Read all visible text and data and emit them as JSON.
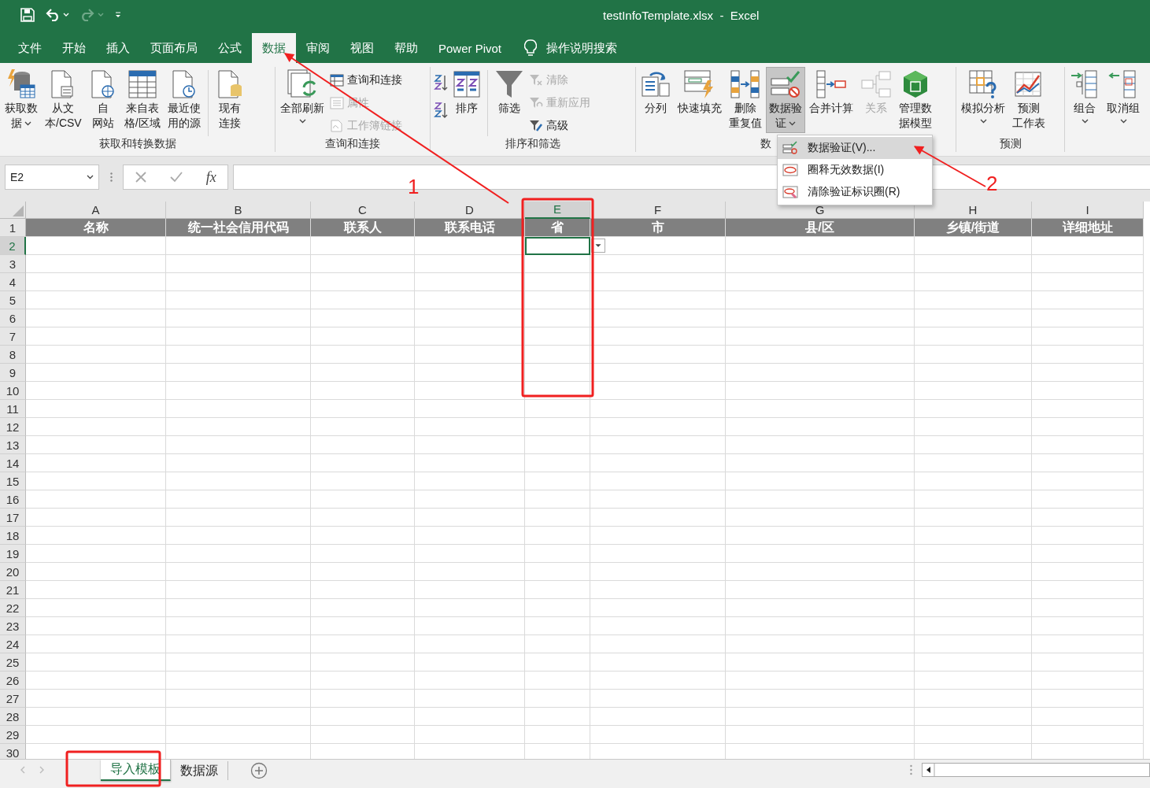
{
  "title_bar": {
    "title": "testInfoTemplate.xlsx  -  Excel"
  },
  "menu_tabs": [
    {
      "label": "文件",
      "selected": false
    },
    {
      "label": "开始",
      "selected": false
    },
    {
      "label": "插入",
      "selected": false
    },
    {
      "label": "页面布局",
      "selected": false
    },
    {
      "label": "公式",
      "selected": false
    },
    {
      "label": "数据",
      "selected": true
    },
    {
      "label": "审阅",
      "selected": false
    },
    {
      "label": "视图",
      "selected": false
    },
    {
      "label": "帮助",
      "selected": false
    },
    {
      "label": "Power Pivot",
      "selected": false
    }
  ],
  "tell_me": {
    "label": "操作说明搜索"
  },
  "ribbon_groups": [
    {
      "label": "获取和转换数据",
      "items": [
        {
          "kind": "large",
          "lines": [
            "获取数",
            "据"
          ],
          "caret": true,
          "disabled": false,
          "pressed": false
        },
        {
          "kind": "large",
          "lines": [
            "从文",
            "本/CSV"
          ],
          "caret": false,
          "disabled": false,
          "pressed": false
        },
        {
          "kind": "large",
          "lines": [
            "自",
            "网站"
          ],
          "caret": false,
          "disabled": false,
          "pressed": false
        },
        {
          "kind": "large",
          "lines": [
            "来自表",
            "格/区域"
          ],
          "caret": false,
          "disabled": false,
          "pressed": false
        },
        {
          "kind": "large",
          "lines": [
            "最近使",
            "用的源"
          ],
          "caret": false,
          "disabled": false,
          "pressed": false
        },
        {
          "kind": "separator"
        },
        {
          "kind": "large",
          "lines": [
            "现有",
            "连接"
          ],
          "caret": false,
          "disabled": false,
          "pressed": false
        }
      ]
    },
    {
      "label": "查询和连接",
      "items": [
        {
          "kind": "large",
          "lines": [
            "全部刷新"
          ],
          "caret": true,
          "disabled": false,
          "pressed": false
        },
        {
          "kind": "stack",
          "items": [
            {
              "label": "查询和连接",
              "disabled": false
            },
            {
              "label": "属性",
              "disabled": true
            },
            {
              "label": "工作簿链接",
              "disabled": true
            }
          ]
        }
      ]
    },
    {
      "label": "排序和筛选",
      "items": [
        {
          "kind": "stack",
          "items": [
            {
              "disabled": false
            },
            {
              "disabled": false
            }
          ]
        },
        {
          "kind": "large",
          "lines": [
            "排序"
          ],
          "caret": false,
          "disabled": false,
          "pressed": false
        },
        {
          "kind": "separator"
        },
        {
          "kind": "large",
          "lines": [
            "筛选"
          ],
          "caret": false,
          "disabled": false,
          "pressed": false
        },
        {
          "kind": "stack",
          "items": [
            {
              "label": "清除",
              "disabled": true
            },
            {
              "label": "重新应用",
              "disabled": true
            },
            {
              "label": "高级",
              "disabled": false
            }
          ]
        }
      ]
    },
    {
      "label": "数",
      "items": [
        {
          "kind": "large",
          "lines": [
            "分列"
          ],
          "caret": false,
          "disabled": false,
          "pressed": false
        },
        {
          "kind": "large",
          "lines": [
            "快速填充"
          ],
          "caret": false,
          "disabled": false,
          "pressed": false
        },
        {
          "kind": "large",
          "lines": [
            "删除",
            "重复值"
          ],
          "caret": false,
          "disabled": false,
          "pressed": false
        },
        {
          "kind": "large",
          "lines": [
            "数据验",
            "证"
          ],
          "caret": true,
          "disabled": false,
          "pressed": true
        },
        {
          "kind": "large",
          "lines": [
            "合并计算"
          ],
          "caret": false,
          "disabled": false,
          "pressed": false
        },
        {
          "kind": "large",
          "lines": [
            "关系"
          ],
          "caret": false,
          "disabled": true,
          "pressed": false
        },
        {
          "kind": "large",
          "lines": [
            "管理数",
            "据模型"
          ],
          "caret": false,
          "disabled": false,
          "pressed": false
        }
      ]
    },
    {
      "label": "预测",
      "items": [
        {
          "kind": "large",
          "lines": [
            "模拟分析"
          ],
          "caret": true,
          "disabled": false,
          "pressed": false
        },
        {
          "kind": "large",
          "lines": [
            "预测",
            "工作表"
          ],
          "caret": false,
          "disabled": false,
          "pressed": false
        }
      ]
    },
    {
      "items": [
        {
          "kind": "large",
          "lines": [
            "组合"
          ],
          "caret": true,
          "disabled": false,
          "pressed": false
        },
        {
          "kind": "large",
          "lines": [
            "取消组"
          ],
          "caret": true,
          "disabled": false,
          "pressed": false
        }
      ]
    }
  ],
  "validation_menu": [
    {
      "label": "数据验证(V)...",
      "selected": true
    },
    {
      "label": "圈释无效数据(I)",
      "selected": false
    },
    {
      "label": "清除验证标识圈(R)",
      "selected": false
    }
  ],
  "formula_bar": {
    "name_box": "E2",
    "function_label": "fx"
  },
  "columns": [
    {
      "letter": "A",
      "header": "名称",
      "selected": false
    },
    {
      "letter": "B",
      "header": "统一社会信用代码",
      "selected": false
    },
    {
      "letter": "C",
      "header": "联系人",
      "selected": false
    },
    {
      "letter": "D",
      "header": "联系电话",
      "selected": false
    },
    {
      "letter": "E",
      "header": "省",
      "selected": true
    },
    {
      "letter": "F",
      "header": "市",
      "selected": false
    },
    {
      "letter": "G",
      "header": "县/区",
      "selected": false
    },
    {
      "letter": "H",
      "header": "乡镇/街道",
      "selected": false
    },
    {
      "letter": "I",
      "header": "详细地址",
      "selected": false
    }
  ],
  "rows": [
    {
      "label": "1",
      "selected": false
    },
    {
      "label": "2",
      "selected": true
    },
    {
      "label": "3",
      "selected": false
    },
    {
      "label": "4",
      "selected": false
    },
    {
      "label": "5",
      "selected": false
    },
    {
      "label": "6",
      "selected": false
    },
    {
      "label": "7",
      "selected": false
    },
    {
      "label": "8",
      "selected": false
    },
    {
      "label": "9",
      "selected": false
    },
    {
      "label": "10",
      "selected": false
    },
    {
      "label": "11",
      "selected": false
    },
    {
      "label": "12",
      "selected": false
    },
    {
      "label": "13",
      "selected": false
    },
    {
      "label": "14",
      "selected": false
    },
    {
      "label": "15",
      "selected": false
    },
    {
      "label": "16",
      "selected": false
    },
    {
      "label": "17",
      "selected": false
    },
    {
      "label": "18",
      "selected": false
    },
    {
      "label": "19",
      "selected": false
    },
    {
      "label": "20",
      "selected": false
    },
    {
      "label": "21",
      "selected": false
    },
    {
      "label": "22",
      "selected": false
    },
    {
      "label": "23",
      "selected": false
    },
    {
      "label": "24",
      "selected": false
    },
    {
      "label": "25",
      "selected": false
    },
    {
      "label": "26",
      "selected": false
    },
    {
      "label": "27",
      "selected": false
    },
    {
      "label": "28",
      "selected": false
    },
    {
      "label": "29",
      "selected": false
    },
    {
      "label": "30",
      "selected": false
    }
  ],
  "validation_dropdown": true,
  "sheet_tabs": [
    {
      "label": "导入模板",
      "selected": true
    },
    {
      "label": "数据源",
      "selected": false
    }
  ],
  "annotations": [
    {
      "kind": "box"
    },
    {
      "kind": "box"
    },
    {
      "kind": "arrow",
      "label": "1"
    },
    {
      "kind": "arrow",
      "label": "2"
    }
  ]
}
